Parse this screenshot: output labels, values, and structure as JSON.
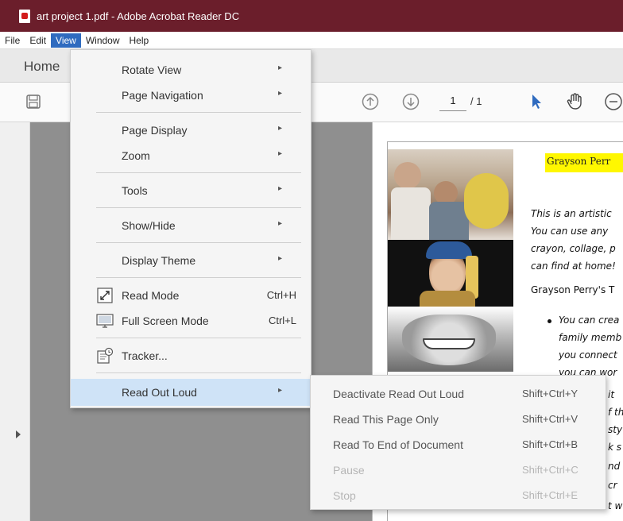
{
  "window": {
    "title": "art project 1.pdf - Adobe Acrobat Reader DC"
  },
  "menubar": {
    "items": [
      "File",
      "Edit",
      "View",
      "Window",
      "Help"
    ],
    "active": "View"
  },
  "tabs": {
    "home": "Home"
  },
  "toolbar": {
    "page_current": "1",
    "page_total": "/ 1"
  },
  "view_menu": {
    "items": [
      {
        "label": "Rotate View",
        "submenu": true
      },
      {
        "label": "Page Navigation",
        "submenu": true
      },
      {
        "label": "Page Display",
        "submenu": true
      },
      {
        "label": "Zoom",
        "submenu": true
      },
      {
        "label": "Tools",
        "submenu": true
      },
      {
        "label": "Show/Hide",
        "submenu": true
      },
      {
        "label": "Display Theme",
        "submenu": true
      },
      {
        "label": "Read Mode",
        "shortcut": "Ctrl+H",
        "icon": "read-mode-icon"
      },
      {
        "label": "Full Screen Mode",
        "shortcut": "Ctrl+L",
        "icon": "full-screen-icon"
      },
      {
        "label": "Tracker...",
        "icon": "tracker-icon"
      },
      {
        "label": "Read Out Loud",
        "submenu": true,
        "highlighted": true
      }
    ],
    "arrow": "▸"
  },
  "read_out_loud_menu": {
    "items": [
      {
        "label": "Deactivate Read Out Loud",
        "shortcut": "Shift+Ctrl+Y",
        "enabled": true
      },
      {
        "label": "Read This Page Only",
        "shortcut": "Shift+Ctrl+V",
        "enabled": true
      },
      {
        "label": "Read To End of Document",
        "shortcut": "Shift+Ctrl+B",
        "enabled": true
      },
      {
        "label": "Pause",
        "shortcut": "Shift+Ctrl+C",
        "enabled": false
      },
      {
        "label": "Stop",
        "shortcut": "Shift+Ctrl+E",
        "enabled": false
      }
    ]
  },
  "document": {
    "heading": "Grayson Perr",
    "lines": [
      "This is an artistic",
      "You can use any",
      "crayon, collage, p",
      "can find at home!",
      "Grayson Perry's T",
      "You can crea",
      "family memb",
      "you connect",
      "you can wor"
    ],
    "clipped_right": [
      "it",
      "f th",
      "sty",
      "k s",
      "nd",
      "cr",
      "t w"
    ]
  },
  "colors": {
    "titlebar": "#6b1e2b",
    "menu_active": "#2f6bbf",
    "menu_highlight": "#cfe3f7",
    "heading_highlight": "#fff700",
    "cursor_icon": "#2f6bbf"
  }
}
